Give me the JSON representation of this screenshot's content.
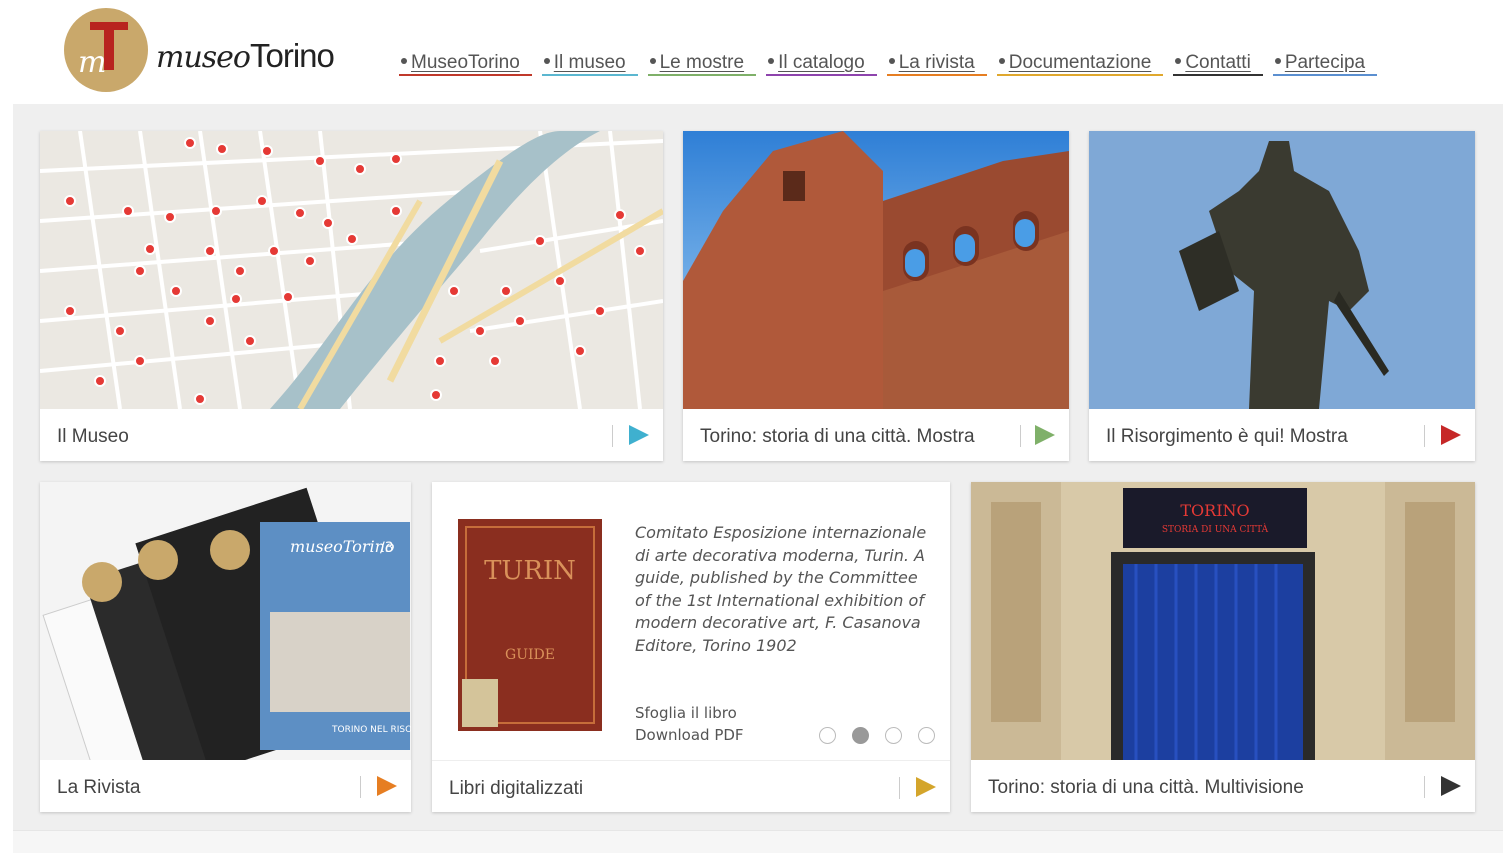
{
  "header": {
    "logo_italic": "museo",
    "logo_regular": "Torino",
    "logo_mark": "mT"
  },
  "nav": [
    {
      "label": "MuseoTorino",
      "color": "#c0392b"
    },
    {
      "label": "Il museo",
      "color": "#5bb7d0"
    },
    {
      "label": "Le mostre",
      "color": "#7fb069"
    },
    {
      "label": "Il catalogo",
      "color": "#8e44ad"
    },
    {
      "label": "La rivista",
      "color": "#e67e22"
    },
    {
      "label": "Documentazione",
      "color": "#e0a82e"
    },
    {
      "label": "Contatti",
      "color": "#333333"
    },
    {
      "label": "Partecipa",
      "color": "#5b8fd0"
    }
  ],
  "tiles": {
    "museo": {
      "label": "Il Museo",
      "arrow_color": "#3fb0cf"
    },
    "storia": {
      "label": "Torino: storia di una città. Mostra",
      "arrow_color": "#7fb069"
    },
    "risorgimento": {
      "label": "Il Risorgimento è qui! Mostra",
      "arrow_color": "#c62828"
    },
    "rivista": {
      "label": "La Rivista",
      "arrow_color": "#e67e22"
    },
    "libri": {
      "label": "Libri digitalizzati",
      "arrow_color": "#d4a52b",
      "description": "Comitato Esposizione internazionale di arte decorativa moderna, Turin. A guide, published by the Committee of the 1st International exhibition of modern decorative art, F. Casanova Editore, Torino 1902",
      "link_browse": "Sfoglia il libro",
      "link_pdf": "Download PDF",
      "cover_title": "TURIN",
      "cover_subtitle": "GUIDE",
      "pager_active": 2,
      "pager_count": 4
    },
    "multivisione": {
      "label": "Torino: storia di una città. Multivisione",
      "arrow_color": "#333333",
      "screen_title": "TORINO",
      "screen_subtitle": "STORIA DI UNA CITTÀ"
    },
    "rivista_cover_title": "museoTorino",
    "rivista_issue": "/3",
    "rivista_headline": "TORINO NEL RISO"
  }
}
